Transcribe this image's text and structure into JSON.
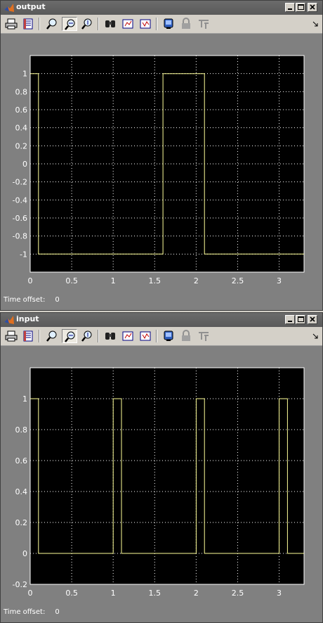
{
  "output_window": {
    "title": "output",
    "time_offset_label": "Time offset:",
    "time_offset_value": "0"
  },
  "input_window": {
    "title": "input",
    "time_offset_label": "Time offset:",
    "time_offset_value": "0"
  },
  "toolbar": {
    "icons": [
      "print-icon",
      "parameters-icon",
      "zoom-icon",
      "zoom-x-icon",
      "zoom-y-icon",
      "autoscale-binoculars-icon",
      "save-axes-settings-icon",
      "restore-axes-settings-icon",
      "floating-scope-icon",
      "lock-axes-icon",
      "signal-selection-icon"
    ],
    "pressed": "zoom-x-icon"
  },
  "colors": {
    "plot_background": "#000000",
    "grid": "#ffffff",
    "signal": "#ffff99",
    "window_background": "#808080"
  },
  "chart_data": [
    {
      "type": "line",
      "title": "",
      "xlabel": "",
      "ylabel": "",
      "xlim": [
        0,
        3.3
      ],
      "ylim": [
        -1.2,
        1.2
      ],
      "grid": true,
      "x_ticks": [
        "0",
        "0.5",
        "1",
        "1.5",
        "2",
        "2.5",
        "3"
      ],
      "y_ticks": [
        "1",
        "0.8",
        "0.6",
        "0.4",
        "0.2",
        "0",
        "-0.2",
        "-0.4",
        "-0.6",
        "-0.8",
        "-1"
      ],
      "series": [
        {
          "x": [
            0,
            0.1,
            0.1,
            1.6,
            1.6,
            2.1,
            2.1,
            3.3
          ],
          "y": [
            1,
            1,
            -1,
            -1,
            1,
            1,
            -1,
            -1
          ]
        }
      ]
    },
    {
      "type": "line",
      "title": "",
      "xlabel": "",
      "ylabel": "",
      "xlim": [
        0,
        3.3
      ],
      "ylim": [
        -0.2,
        1.2
      ],
      "grid": true,
      "x_ticks": [
        "0",
        "0.5",
        "1",
        "1.5",
        "2",
        "2.5",
        "3"
      ],
      "y_ticks": [
        "1",
        "0.8",
        "0.6",
        "0.4",
        "0.2",
        "0",
        "-0.2"
      ],
      "series": [
        {
          "x": [
            0,
            0.1,
            0.1,
            1.0,
            1.0,
            1.1,
            1.1,
            2.0,
            2.0,
            2.1,
            2.1,
            3.0,
            3.0,
            3.1,
            3.1,
            3.3
          ],
          "y": [
            1,
            1,
            0,
            0,
            1,
            1,
            0,
            0,
            1,
            1,
            0,
            0,
            1,
            1,
            0,
            0
          ]
        }
      ]
    }
  ]
}
